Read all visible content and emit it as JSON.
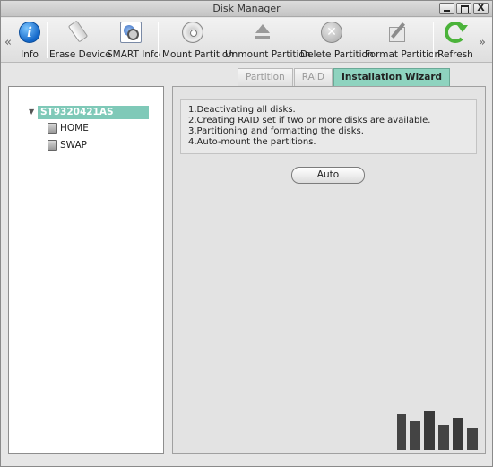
{
  "window": {
    "title": "Disk Manager",
    "buttons": {
      "minimize": "",
      "maximize": "",
      "close": "X"
    }
  },
  "toolbar": {
    "scroll_left": "«",
    "scroll_right": "»",
    "items": [
      {
        "label": "Info",
        "icon": "info-icon"
      },
      {
        "label": "Erase Device",
        "icon": "eraser-icon"
      },
      {
        "label": "SMART Info",
        "icon": "smart-info-icon"
      },
      {
        "label": "Mount Partition",
        "icon": "disc-icon"
      },
      {
        "label": "Unmount Partition",
        "icon": "eject-icon"
      },
      {
        "label": "Delete Partition",
        "icon": "delete-icon"
      },
      {
        "label": "Format Partition",
        "icon": "format-icon"
      },
      {
        "label": "Refresh",
        "icon": "refresh-icon"
      }
    ]
  },
  "tree": {
    "expander": "▼",
    "root": "ST9320421AS",
    "children": [
      "HOME",
      "SWAP"
    ]
  },
  "tabs": [
    {
      "label": "Partition",
      "active": false
    },
    {
      "label": "RAID",
      "active": false
    },
    {
      "label": "Installation Wizard",
      "active": true
    }
  ],
  "wizard": {
    "steps": [
      "1.Deactivating all disks.",
      "2.Creating RAID set if two or more disks are available.",
      "3.Partitioning and formatting the disks.",
      "4.Auto-mount the partitions."
    ],
    "auto_button": "Auto"
  },
  "colors": {
    "selection": "#7fc9b8",
    "active_tab": "#8ed3bf"
  }
}
